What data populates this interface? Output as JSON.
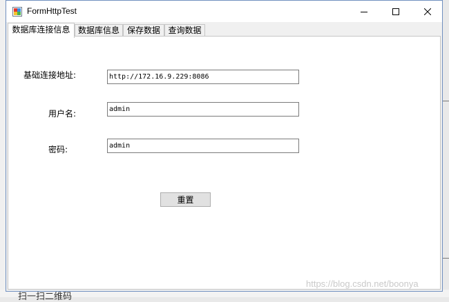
{
  "window": {
    "title": "FormHttpTest"
  },
  "tabs": [
    {
      "label": "数据库连接信息"
    },
    {
      "label": "数据库信息"
    },
    {
      "label": "保存数据"
    },
    {
      "label": "查询数据"
    }
  ],
  "form": {
    "base_url_label": "基础连接地址:",
    "base_url_value": "http://172.16.9.229:8086",
    "username_label": "用户名:",
    "username_value": "admin",
    "password_label": "密码:",
    "password_value": "admin",
    "reset_label": "重置"
  },
  "background": {
    "bottom_text": "扫一扫二维码",
    "watermark": "https://blog.csdn.net/boonya"
  },
  "icons": [
    "app-icon",
    "minimize-icon",
    "maximize-icon",
    "close-icon"
  ]
}
